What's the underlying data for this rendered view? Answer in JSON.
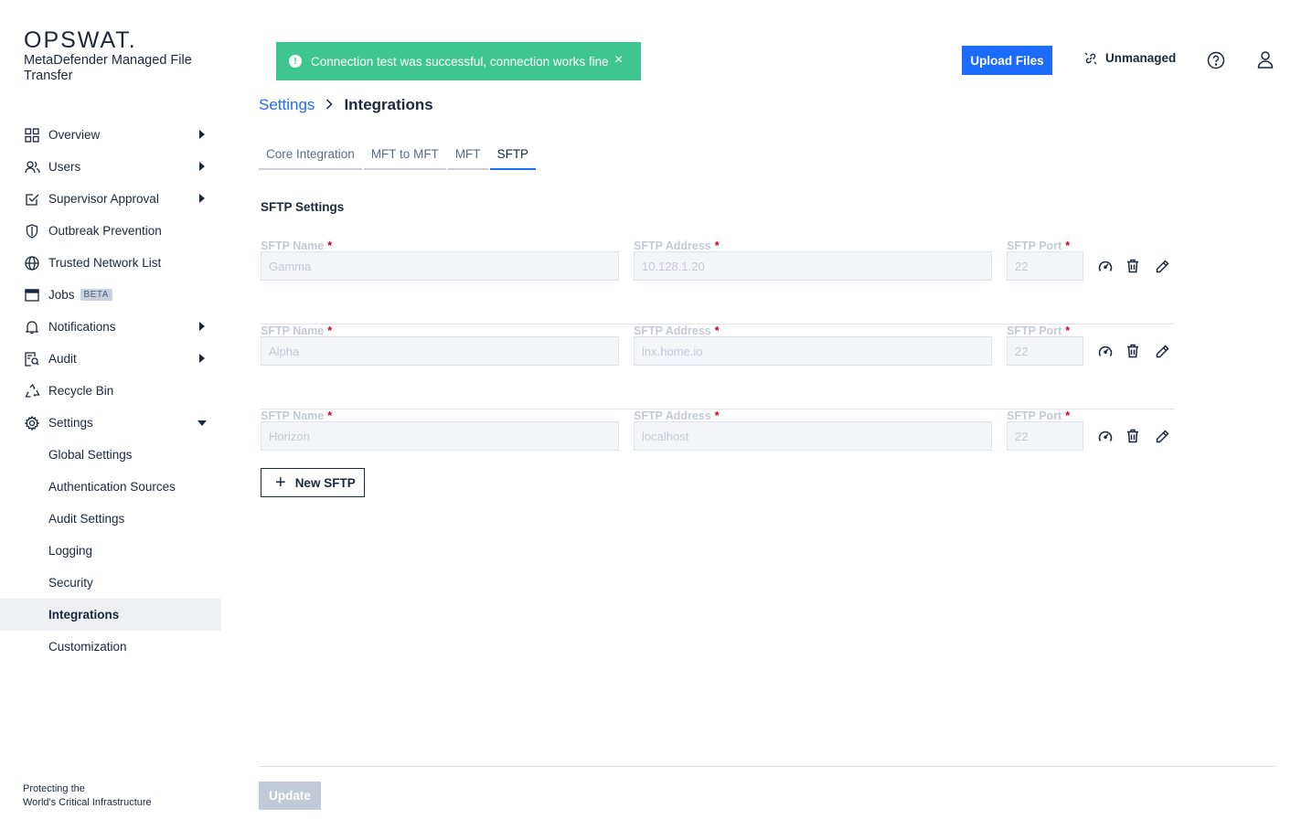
{
  "brand": {
    "logo": "OPSWAT.",
    "product": "MetaDefender Managed File Transfer",
    "tagline_line1": "Protecting the",
    "tagline_line2": "World's Critical Infrastructure"
  },
  "sidebar": {
    "items": [
      {
        "label": "Overview",
        "icon": "grid-icon",
        "arrow": "right"
      },
      {
        "label": "Users",
        "icon": "users-icon",
        "arrow": "right"
      },
      {
        "label": "Supervisor Approval",
        "icon": "checkbox-icon",
        "arrow": "right"
      },
      {
        "label": "Outbreak Prevention",
        "icon": "shield-icon"
      },
      {
        "label": "Trusted Network List",
        "icon": "globe-icon"
      },
      {
        "label": "Jobs",
        "icon": "window-icon",
        "badge": "BETA"
      },
      {
        "label": "Notifications",
        "icon": "bell-icon",
        "arrow": "right"
      },
      {
        "label": "Audit",
        "icon": "audit-icon",
        "arrow": "right"
      },
      {
        "label": "Recycle Bin",
        "icon": "recycle-icon"
      },
      {
        "label": "Settings",
        "icon": "gear-icon",
        "arrow": "down"
      }
    ],
    "sub_items": [
      {
        "label": "Global Settings"
      },
      {
        "label": "Authentication Sources"
      },
      {
        "label": "Audit Settings"
      },
      {
        "label": "Logging"
      },
      {
        "label": "Security"
      },
      {
        "label": "Integrations",
        "active": true
      },
      {
        "label": "Customization"
      }
    ]
  },
  "toast": {
    "message": "Connection test was successful, connection works fine",
    "close": "×",
    "color": "#3fc58f"
  },
  "header": {
    "upload_label": "Upload Files",
    "unmanaged_label": "Unmanaged",
    "accent": "#1d6bfc"
  },
  "breadcrumb": {
    "parent": "Settings",
    "current": "Integrations"
  },
  "tabs": [
    {
      "label": "Core Integration"
    },
    {
      "label": "MFT to MFT"
    },
    {
      "label": "MFT"
    },
    {
      "label": "SFTP",
      "active": true
    }
  ],
  "section": {
    "title": "SFTP Settings",
    "name_label": "SFTP Name",
    "address_label": "SFTP Address",
    "port_label": "SFTP Port",
    "required_mark": "*"
  },
  "sftp_rows": [
    {
      "name": "Gamma",
      "address": "10.128.1.20",
      "port": "22"
    },
    {
      "name": "Alpha",
      "address": "lnx.home.io",
      "port": "22"
    },
    {
      "name": "Horizon",
      "address": "localhost",
      "port": "22"
    }
  ],
  "actions": {
    "new_sftp_label": "New SFTP",
    "new_sftp_plus": "+",
    "update_label": "Update"
  }
}
